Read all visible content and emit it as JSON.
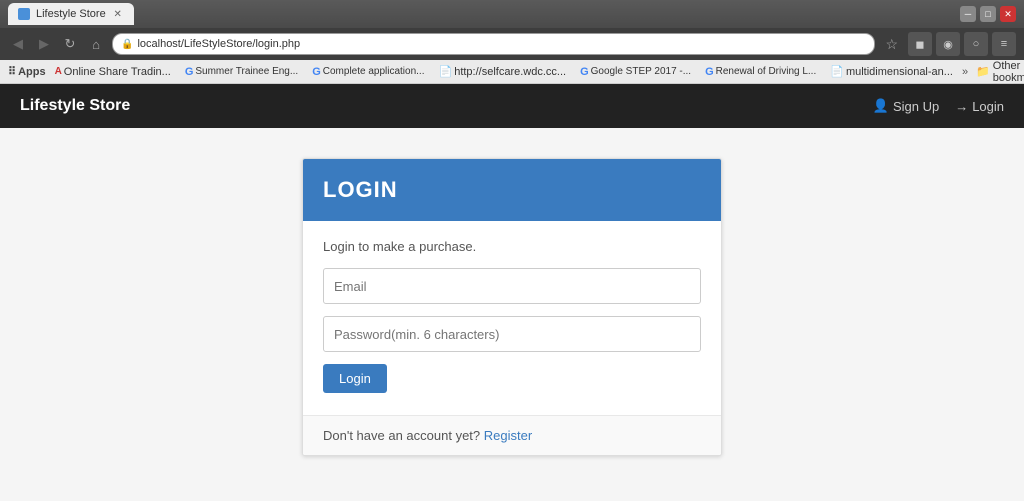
{
  "browser": {
    "tab_title": "Lifestyle Store",
    "url": "localhost/LifeStyleStore/login.php",
    "bookmarks": [
      {
        "label": "Apps",
        "type": "apps"
      },
      {
        "label": "Online Share Trading",
        "type": "item",
        "icon": "A"
      },
      {
        "label": "Summer Trainee Eng...",
        "type": "google"
      },
      {
        "label": "Complete application...",
        "type": "google"
      },
      {
        "label": "http://selfcare.wdc.cc...",
        "type": "doc"
      },
      {
        "label": "Google STEP 2017 -...",
        "type": "google"
      },
      {
        "label": "Renewal of Driving L...",
        "type": "google"
      },
      {
        "label": "multidimensional-an...",
        "type": "doc"
      }
    ],
    "more_label": "»",
    "other_bookmarks_label": "Other bookmarks"
  },
  "navbar": {
    "brand": "Lifestyle Store",
    "links": [
      {
        "label": "Sign Up",
        "icon": "user"
      },
      {
        "label": "Login",
        "icon": "arrow"
      }
    ]
  },
  "login": {
    "title": "LOGIN",
    "subtitle": "Login to make a purchase.",
    "email_placeholder": "Email",
    "password_placeholder": "Password(min. 6 characters)",
    "button_label": "Login",
    "footer_text": "Don't have an account yet?",
    "register_link": "Register"
  }
}
